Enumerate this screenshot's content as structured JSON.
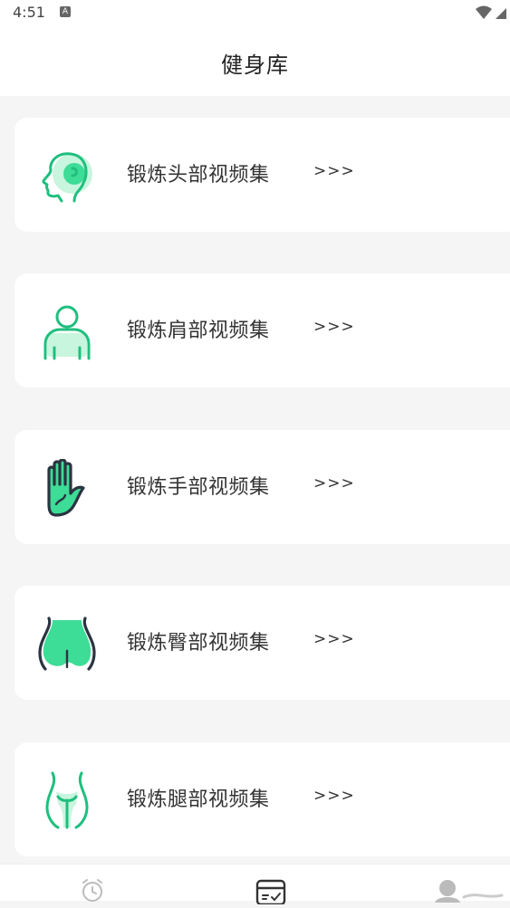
{
  "status": {
    "time": "4:51",
    "notif_letter": "A"
  },
  "header": {
    "title": "健身库"
  },
  "cards": [
    {
      "label": "锻炼头部视频集",
      "arrow": ">>>",
      "icon": "head-icon"
    },
    {
      "label": "锻炼肩部视频集",
      "arrow": ">>>",
      "icon": "shoulder-icon"
    },
    {
      "label": "锻炼手部视频集",
      "arrow": ">>>",
      "icon": "hand-icon"
    },
    {
      "label": "锻炼臀部视频集",
      "arrow": ">>>",
      "icon": "hip-icon"
    },
    {
      "label": "锻炼腿部视频集",
      "arrow": ">>>",
      "icon": "leg-icon"
    }
  ],
  "tabbar": {
    "tabs": [
      "alarm-clock-icon",
      "calendar-check-icon",
      "profile-icon"
    ]
  },
  "colors": {
    "accent": "#3ddc97",
    "accent_dark": "#1fbf7e",
    "outline_dark": "#2b3440"
  }
}
